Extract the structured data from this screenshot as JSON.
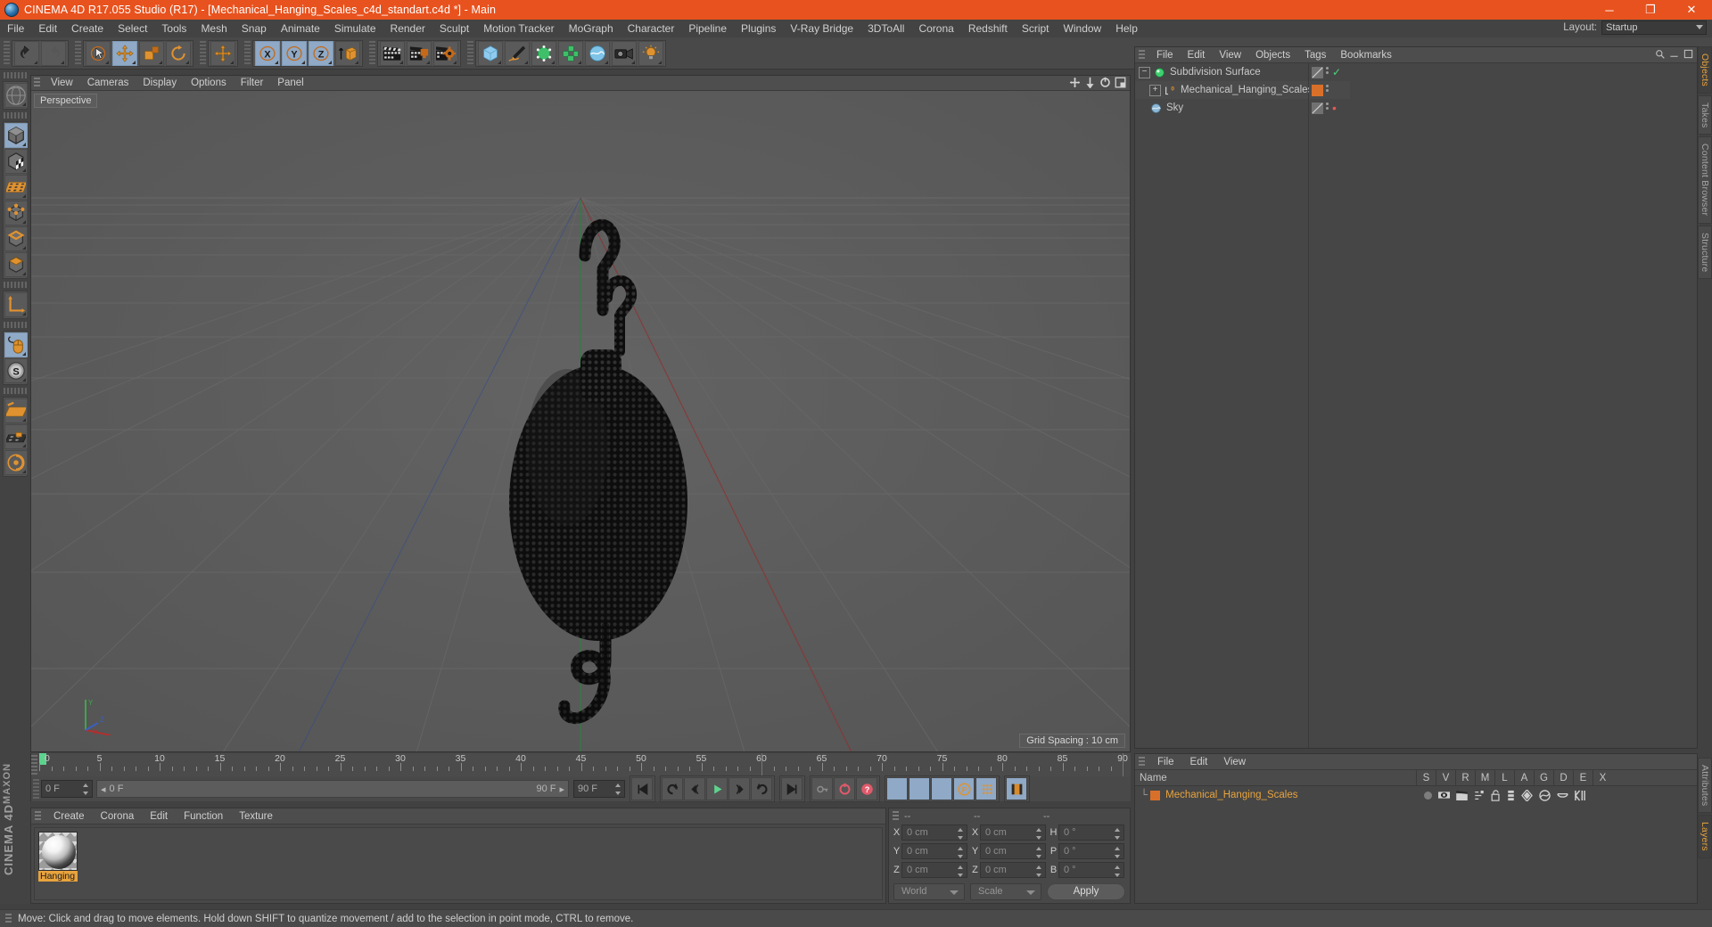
{
  "window": {
    "title": "CINEMA 4D R17.055 Studio (R17) - [Mechanical_Hanging_Scales_c4d_standart.c4d *] - Main",
    "app_icon": "c4d-logo-icon",
    "minimize": "─",
    "maximize": "❐",
    "close": "✕"
  },
  "menubar": {
    "items": [
      "File",
      "Edit",
      "Create",
      "Select",
      "Tools",
      "Mesh",
      "Snap",
      "Animate",
      "Simulate",
      "Render",
      "Sculpt",
      "Motion Tracker",
      "MoGraph",
      "Character",
      "Pipeline",
      "Plugins",
      "V-Ray Bridge",
      "3DToAll",
      "Corona",
      "Redshift",
      "Script",
      "Window",
      "Help"
    ],
    "layout_label": "Layout:",
    "layout_value": "Startup"
  },
  "toolbar": {
    "groups": [
      {
        "name": "undo-redo",
        "buttons": [
          {
            "name": "undo-button",
            "icon": "undo-arrow-icon",
            "active": false
          },
          {
            "name": "redo-button",
            "icon": "redo-arrow-icon",
            "active": false
          }
        ]
      },
      {
        "name": "transform-tools",
        "buttons": [
          {
            "name": "selection-tool",
            "icon": "live-selection-icon",
            "active": false
          },
          {
            "name": "move-tool",
            "icon": "move-arrows-icon",
            "active": true
          },
          {
            "name": "scale-tool",
            "icon": "scale-box-icon",
            "active": false
          },
          {
            "name": "rotate-tool",
            "icon": "rotate-ring-icon",
            "active": false
          }
        ]
      },
      {
        "name": "move-mode",
        "buttons": [
          {
            "name": "move-mode-button",
            "icon": "move-arrows-icon",
            "active": false
          }
        ]
      },
      {
        "name": "axis-locks",
        "buttons": [
          {
            "name": "lock-x-axis",
            "icon": "x-axis-icon",
            "active": true
          },
          {
            "name": "lock-y-axis",
            "icon": "y-axis-icon",
            "active": true
          },
          {
            "name": "lock-z-axis",
            "icon": "z-axis-icon",
            "active": true
          },
          {
            "name": "world-object-coord",
            "icon": "world-axis-icon",
            "active": false
          }
        ]
      },
      {
        "name": "render-tools",
        "buttons": [
          {
            "name": "render-view-button",
            "icon": "clapperboard-icon",
            "active": false
          },
          {
            "name": "render-to-picture-viewer-button",
            "icon": "clapperboard-render-icon",
            "active": false
          },
          {
            "name": "render-settings-button",
            "icon": "clapperboard-gear-icon",
            "active": false
          }
        ]
      },
      {
        "name": "create-objects",
        "buttons": [
          {
            "name": "add-cube-button",
            "icon": "cube-icon",
            "active": false
          },
          {
            "name": "add-spline-button",
            "icon": "pen-spline-icon",
            "active": false
          },
          {
            "name": "add-generator-button",
            "icon": "green-generator-icon",
            "active": false
          },
          {
            "name": "add-deformer-button",
            "icon": "green-deformer-icon",
            "active": false
          },
          {
            "name": "add-environment-button",
            "icon": "sky-environment-icon",
            "active": false
          },
          {
            "name": "add-camera-button",
            "icon": "camera-icon",
            "active": false
          },
          {
            "name": "add-light-button",
            "icon": "light-bulb-icon",
            "active": false
          }
        ]
      }
    ]
  },
  "left_toolbar": {
    "buttons": [
      {
        "name": "make-editable-button",
        "icon": "make-editable-icon",
        "active": false
      },
      {
        "name": "model-mode-button",
        "icon": "model-cube-icon",
        "active": true
      },
      {
        "name": "texture-mode-button",
        "icon": "texture-checker-cube-icon",
        "active": false
      },
      {
        "name": "uv-mesh-button",
        "icon": "uv-grid-icon",
        "active": false
      },
      {
        "name": "points-mode-button",
        "icon": "points-cube-icon",
        "active": false
      },
      {
        "name": "edges-mode-button",
        "icon": "edges-cube-icon",
        "active": false
      },
      {
        "name": "polygons-mode-button",
        "icon": "polygons-cube-icon",
        "active": false
      },
      {
        "name": "axis-modify-button",
        "icon": "axis-l-icon",
        "active": false
      },
      {
        "name": "enable-viewport-tweak-button",
        "icon": "mouse-icon",
        "active": true
      },
      {
        "name": "enable-snap-button",
        "icon": "snap-s-icon",
        "active": false
      },
      {
        "name": "workplane-button",
        "icon": "workplane-icon",
        "active": false
      },
      {
        "name": "lock-workplane-button",
        "icon": "lock-workplane-icon",
        "active": false
      },
      {
        "name": "workplane-mode-button",
        "icon": "workplane-mode-icon",
        "active": false
      }
    ]
  },
  "brand": {
    "maxon": "MAXON",
    "c4d": "CINEMA 4D"
  },
  "viewport": {
    "menu": [
      "View",
      "Cameras",
      "Display",
      "Options",
      "Filter",
      "Panel"
    ],
    "label": "Perspective",
    "grid_spacing": "Grid Spacing : 10 cm",
    "axis": {
      "x": "X",
      "y": "Y",
      "z": "Z"
    },
    "corner_icons": [
      "move-view-icon",
      "pan-view-icon",
      "rotate-view-icon",
      "maximize-view-icon"
    ]
  },
  "timeline": {
    "ticks": [
      "0",
      "5",
      "10",
      "15",
      "20",
      "25",
      "30",
      "35",
      "40",
      "45",
      "50",
      "55",
      "60",
      "65",
      "70",
      "75",
      "80",
      "85",
      "90"
    ],
    "current_frame_marker": 0,
    "start_frame": "0 F",
    "end_frame": "90 F",
    "scrub_left": "0 F",
    "scrub_right": "90 F",
    "preview_end": "90 F",
    "right_frame_field": "0 F",
    "transport_buttons": [
      {
        "name": "go-to-start-button",
        "icon": "skip-start-icon"
      },
      {
        "name": "play-reverse-loop-button",
        "icon": "loop-back-icon"
      },
      {
        "name": "step-back-button",
        "icon": "step-back-icon"
      },
      {
        "name": "play-button",
        "icon": "play-icon"
      },
      {
        "name": "step-forward-button",
        "icon": "step-forward-icon"
      },
      {
        "name": "loop-forward-button",
        "icon": "loop-forward-icon"
      },
      {
        "name": "go-to-end-button",
        "icon": "skip-end-icon"
      }
    ],
    "record_buttons": [
      {
        "name": "autokeying-button",
        "icon": "key-icon"
      },
      {
        "name": "record-active-objects-button",
        "icon": "record-circle-icon"
      },
      {
        "name": "keyframe-selection-button",
        "icon": "question-key-icon"
      }
    ],
    "key_param_buttons": [
      {
        "name": "key-position-button",
        "icon": "move-arrows-icon"
      },
      {
        "name": "key-scale-button",
        "icon": "scale-box-icon"
      },
      {
        "name": "key-rotation-button",
        "icon": "rotate-ring-icon"
      },
      {
        "name": "key-param-button",
        "icon": "p-circle-icon"
      },
      {
        "name": "key-pla-button",
        "icon": "point-level-icon"
      }
    ],
    "extra_buttons": [
      {
        "name": "timeline-toggle-button",
        "icon": "filmstrip-icon"
      }
    ]
  },
  "material_manager": {
    "menu": [
      "Create",
      "Corona",
      "Edit",
      "Function",
      "Texture"
    ],
    "materials": [
      {
        "name": "Hanging",
        "label": "Hanging"
      }
    ]
  },
  "coordinates": {
    "header": [
      "--",
      "--",
      "--"
    ],
    "rows": [
      {
        "label1": "X",
        "value1": "0 cm",
        "label2": "X",
        "value2": "0 cm",
        "label3": "H",
        "value3": "0 °"
      },
      {
        "label1": "Y",
        "value1": "0 cm",
        "label2": "Y",
        "value2": "0 cm",
        "label3": "P",
        "value3": "0 °"
      },
      {
        "label1": "Z",
        "value1": "0 cm",
        "label2": "Z",
        "value2": "0 cm",
        "label3": "B",
        "value3": "0 °"
      }
    ],
    "system": "World",
    "mode": "Scale",
    "apply": "Apply"
  },
  "object_manager": {
    "menu": [
      "File",
      "Edit",
      "View",
      "Objects",
      "Tags",
      "Bookmarks"
    ],
    "right_icons": [
      "search-icon",
      "minimize-icon",
      "maximize-icon"
    ],
    "objects": [
      {
        "name": "Subdivision Surface",
        "icon": "subdivision-surface-icon",
        "expander": "−",
        "indent": 0,
        "tag_color": "",
        "visible_check": "✓"
      },
      {
        "name": "Mechanical_Hanging_Scales",
        "icon": "polygon-object-icon",
        "expander": "+",
        "indent": 1,
        "tag_color": "#d9702a",
        "visible_check": ""
      },
      {
        "name": "Sky",
        "icon": "sky-icon",
        "expander": "",
        "indent": 0,
        "tag_color": "",
        "visible_check": ""
      }
    ]
  },
  "attributes_manager": {
    "menu": [
      "File",
      "Edit",
      "View"
    ],
    "columns": [
      "Name",
      "S",
      "V",
      "R",
      "M",
      "L",
      "A",
      "G",
      "D",
      "E",
      "X"
    ],
    "rows": [
      {
        "name": "Mechanical_Hanging_Scales",
        "swatch": "#d9702a",
        "icons": [
          "solo-dot-icon",
          "visible-eye-icon",
          "render-clapper-icon",
          "motion-icon",
          "unlock-icon",
          "animation-icon",
          "generator-icon",
          "deformer-icon",
          "cache-icon",
          "expression-icon"
        ]
      }
    ]
  },
  "right_tabs_top": [
    {
      "label": "Objects",
      "active": true
    },
    {
      "label": "Takes",
      "active": false
    },
    {
      "label": "Content Browser",
      "active": false
    },
    {
      "label": "Structure",
      "active": false
    }
  ],
  "right_tabs_bottom": [
    {
      "label": "Attributes",
      "active": false
    },
    {
      "label": "Layers",
      "active": true
    }
  ],
  "status_bar": {
    "text": "Move: Click and drag to move elements. Hold down SHIFT to quantize movement / add to the selection in point mode, CTRL to remove."
  },
  "colors": {
    "accent_orange": "#e8521e",
    "selected_text": "#e8a33d",
    "panel_bg": "#464646",
    "viewport_bg": "#5a5a5a",
    "button_active": "#8fa9c6"
  }
}
